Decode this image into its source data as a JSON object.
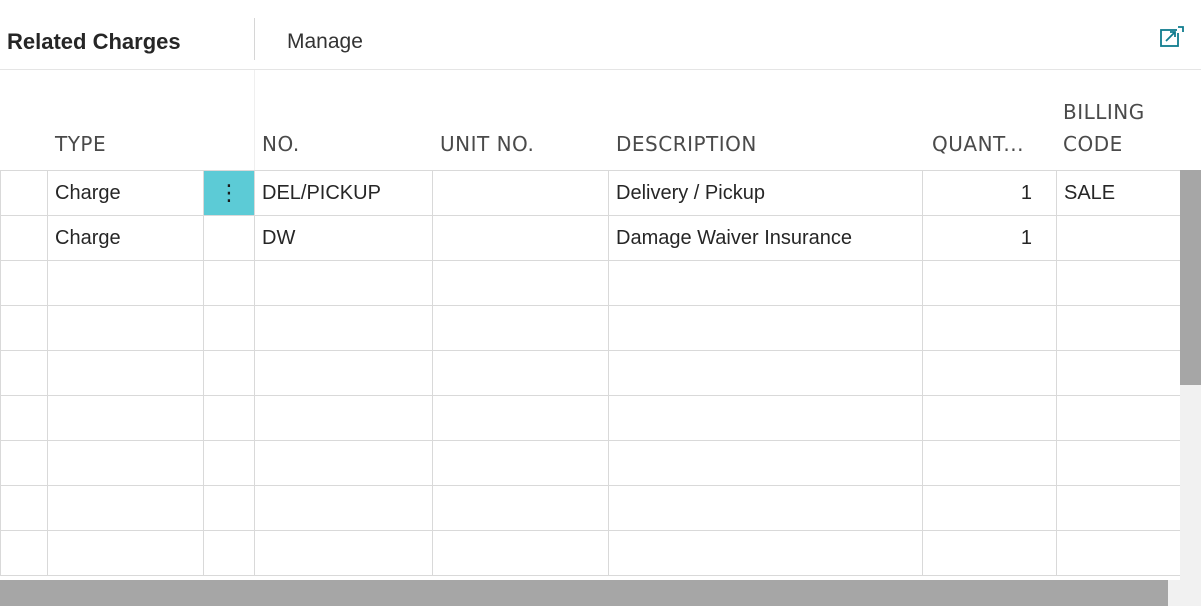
{
  "toolbar": {
    "title": "Related Charges",
    "manage_label": "Manage",
    "expand_icon": "expand-icon",
    "accent_color": "#0f7c8e"
  },
  "grid": {
    "columns": [
      "TYPE",
      "NO.",
      "UNIT NO.",
      "DESCRIPTION",
      "QUANT...",
      "BILLING",
      "CODE"
    ],
    "rows": [
      {
        "type": "Charge",
        "no": "DEL/PICKUP",
        "unit_no": "",
        "description": "Delivery / Pickup",
        "quantity": "1",
        "billing_code": "SALE"
      },
      {
        "type": "Charge",
        "no": "DW",
        "unit_no": "",
        "description": "Damage Waiver Insurance",
        "quantity": "1",
        "billing_code": ""
      }
    ],
    "row_menu_icon": "⋮",
    "selected_row_color": "#5ccbd6"
  }
}
